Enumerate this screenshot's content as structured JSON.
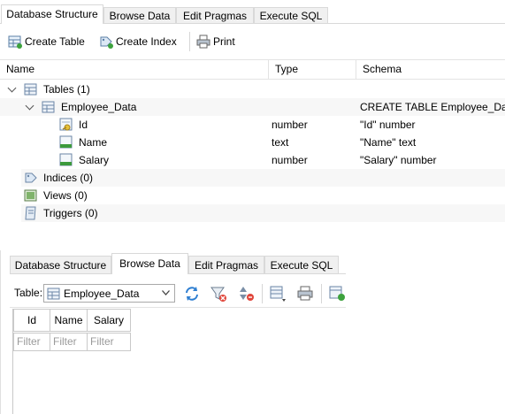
{
  "top": {
    "tabs": [
      "Database Structure",
      "Browse Data",
      "Edit Pragmas",
      "Execute SQL"
    ],
    "toolbar": {
      "create_table": "Create Table",
      "create_index": "Create Index",
      "print": "Print"
    },
    "columns": {
      "name": "Name",
      "type": "Type",
      "schema": "Schema"
    },
    "tree": {
      "tables": "Tables (1)",
      "table": {
        "name": "Employee_Data",
        "schema": "CREATE TABLE Employee_Data"
      },
      "fields": [
        {
          "name": "Id",
          "type": "number",
          "schema": "\"Id\" number"
        },
        {
          "name": "Name",
          "type": "text",
          "schema": "\"Name\" text"
        },
        {
          "name": "Salary",
          "type": "number",
          "schema": "\"Salary\" number"
        }
      ],
      "indices": "Indices (0)",
      "views": "Views (0)",
      "triggers": "Triggers (0)"
    }
  },
  "bottom": {
    "tabs": [
      "Database Structure",
      "Browse Data",
      "Edit Pragmas",
      "Execute SQL"
    ],
    "table_label": "Table:",
    "table_selected": "Employee_Data",
    "grid": {
      "columns": [
        "Id",
        "Name",
        "Salary"
      ],
      "filter_placeholder": "Filter"
    }
  }
}
